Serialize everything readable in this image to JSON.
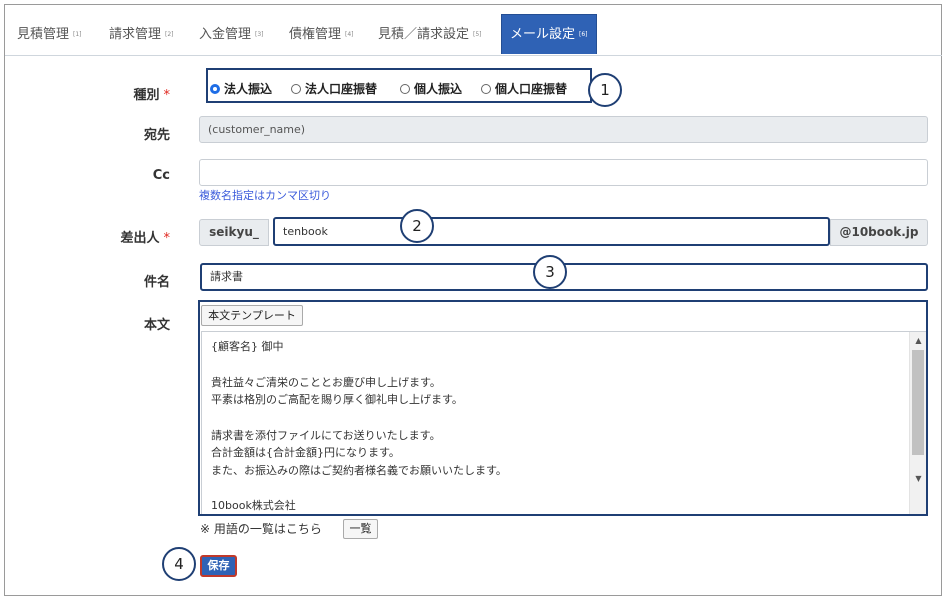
{
  "tabs": [
    {
      "label": "見積管理",
      "sub": "[1]"
    },
    {
      "label": "請求管理",
      "sub": "[2]"
    },
    {
      "label": "入金管理",
      "sub": "[3]"
    },
    {
      "label": "債権管理",
      "sub": "[4]"
    },
    {
      "label": "見積／請求設定",
      "sub": "[5]"
    },
    {
      "label": "メール設定",
      "sub": "[6]",
      "active": true
    }
  ],
  "form": {
    "type": {
      "label": "種別",
      "required_mark": "*",
      "options": [
        "法人振込",
        "法人口座振替",
        "個人振込",
        "個人口座振替"
      ],
      "selected": "法人振込"
    },
    "to": {
      "label": "宛先",
      "value": "(customer_name)"
    },
    "cc": {
      "label": "Cc",
      "value": "",
      "hint": "複数名指定はカンマ区切り"
    },
    "sender": {
      "label": "差出人",
      "required_mark": "*",
      "prefix": "seikyu_",
      "value": "tenbook",
      "suffix": "@10book.jp"
    },
    "subject": {
      "label": "件名",
      "value": "請求書"
    },
    "body": {
      "label": "本文",
      "template_button": "本文テンプレート",
      "lines": [
        "{顧客名} 御中",
        "",
        "貴社益々ご清栄のこととお慶び申し上げます。",
        "平素は格別のご高配を賜り厚く御礼申し上げます。",
        "",
        "請求書を添付ファイルにてお送りいたします。",
        "合計金額は{合計金額}円になります。",
        "また、お振込みの際はご契約者様名義でお願いいたします。",
        "",
        "10book株式会社"
      ]
    },
    "terms_note": "※ 用語の一覧はこちら",
    "terms_button": "一覧",
    "save_button": "保存"
  },
  "callouts": [
    "1",
    "2",
    "3",
    "4"
  ],
  "colors": {
    "accent": "#2f62b5",
    "annotation": "#1f3f74",
    "required": "#e0261e",
    "hint": "#3b5bdb"
  }
}
